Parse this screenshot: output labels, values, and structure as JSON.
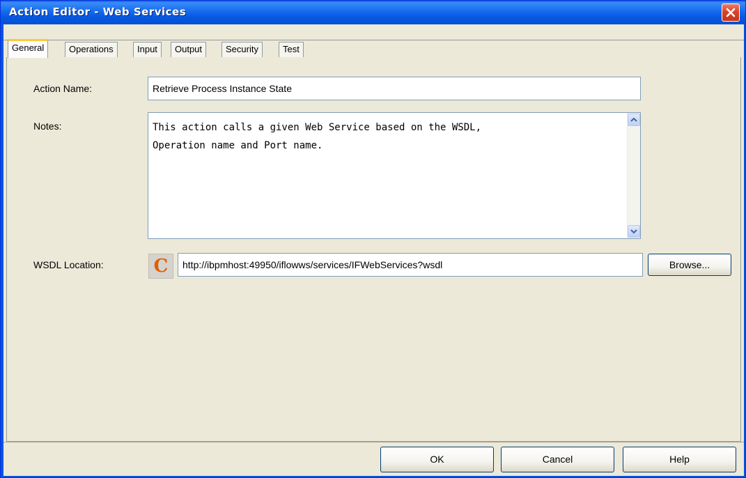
{
  "window": {
    "title": "Action Editor - Web Services"
  },
  "tabs": [
    "General",
    "Operations",
    "Input",
    "Output",
    "Security",
    "Test"
  ],
  "form": {
    "action_name_label": "Action Name:",
    "action_name_value": "Retrieve Process Instance State",
    "notes_label": "Notes:",
    "notes_value": "This action calls a given Web Service based on the WSDL,\nOperation name and Port name.",
    "wsdl_label": "WSDL Location:",
    "wsdl_icon_letter": "C",
    "wsdl_value": "http://ibpmhost:49950/iflowws/services/IFWebServices?wsdl",
    "browse_label": "Browse..."
  },
  "footer": {
    "ok_label": "OK",
    "cancel_label": "Cancel",
    "help_label": "Help"
  },
  "icons": {
    "close": "close-icon",
    "scroll_up": "arrow-up-icon",
    "scroll_down": "arrow-down-icon",
    "wsdl": "c-letter-icon"
  },
  "colors": {
    "title_bar": "#0054e3",
    "close_button": "#d8442a",
    "tab_active_accent": "#ffc83c",
    "c_icon": "#e06000",
    "dialog_bg": "#ece9d8"
  }
}
